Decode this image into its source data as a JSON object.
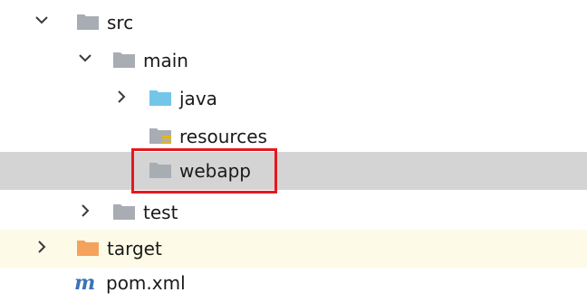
{
  "tree": {
    "nodes": [
      {
        "label": "src",
        "arrow": "expanded",
        "folder": "gray"
      },
      {
        "label": "main",
        "arrow": "expanded",
        "folder": "gray"
      },
      {
        "label": "java",
        "arrow": "collapsed",
        "folder": "blue"
      },
      {
        "label": "resources",
        "arrow": "none",
        "folder": "gray-resources"
      },
      {
        "label": "webapp",
        "arrow": "none",
        "folder": "gray"
      },
      {
        "label": "test",
        "arrow": "collapsed",
        "folder": "gray"
      },
      {
        "label": "target",
        "arrow": "collapsed",
        "folder": "orange"
      },
      {
        "label": "pom.xml",
        "arrow": "none",
        "icon": "m"
      }
    ],
    "selected_node": "webapp",
    "colors": {
      "selected_row": "#d4d4d4",
      "target_row": "#fdfbe7",
      "highlight_box": "#e5181f",
      "folder_gray": "#a8adb3",
      "folder_blue": "#74c6e8",
      "folder_orange": "#f5a25d",
      "maven_m": "#3b72b5"
    }
  }
}
